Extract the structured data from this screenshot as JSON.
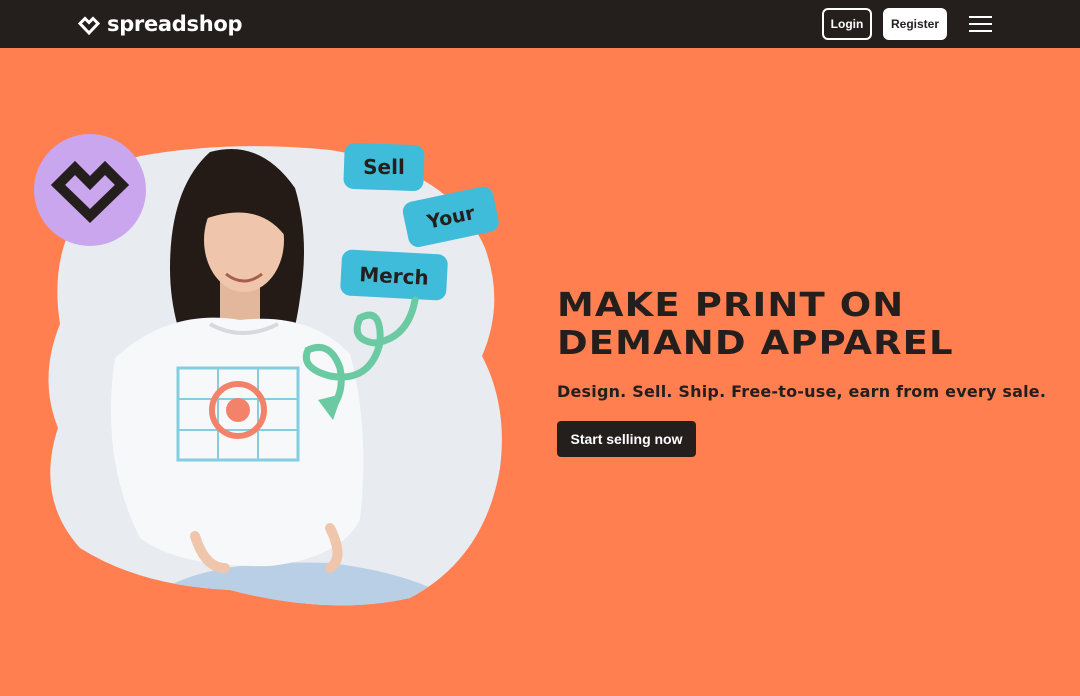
{
  "colors": {
    "page_background": "#ff7f50",
    "navbar_background": "#241f1d",
    "text_dark": "#241f1d",
    "badge_purple": "#c9a6ee",
    "tag_blue": "#3fbcd9",
    "arrow_green": "#6ccaa3"
  },
  "nav": {
    "logo_text": "spreadshop",
    "logo_icon": "heart-logo-icon",
    "login_label": "Login",
    "register_label": "Register",
    "menu_icon": "hamburger-menu-icon"
  },
  "hero": {
    "headline_line1": "MAKE PRINT ON",
    "headline_line2": "DEMAND APPAREL",
    "subheadline": "Design. Sell. Ship. Free-to-use, earn from every sale.",
    "cta_label": "Start selling now",
    "tags": [
      "Sell",
      "Your",
      "Merch"
    ],
    "image_alt": "Woman wearing a white printed sweatshirt"
  }
}
